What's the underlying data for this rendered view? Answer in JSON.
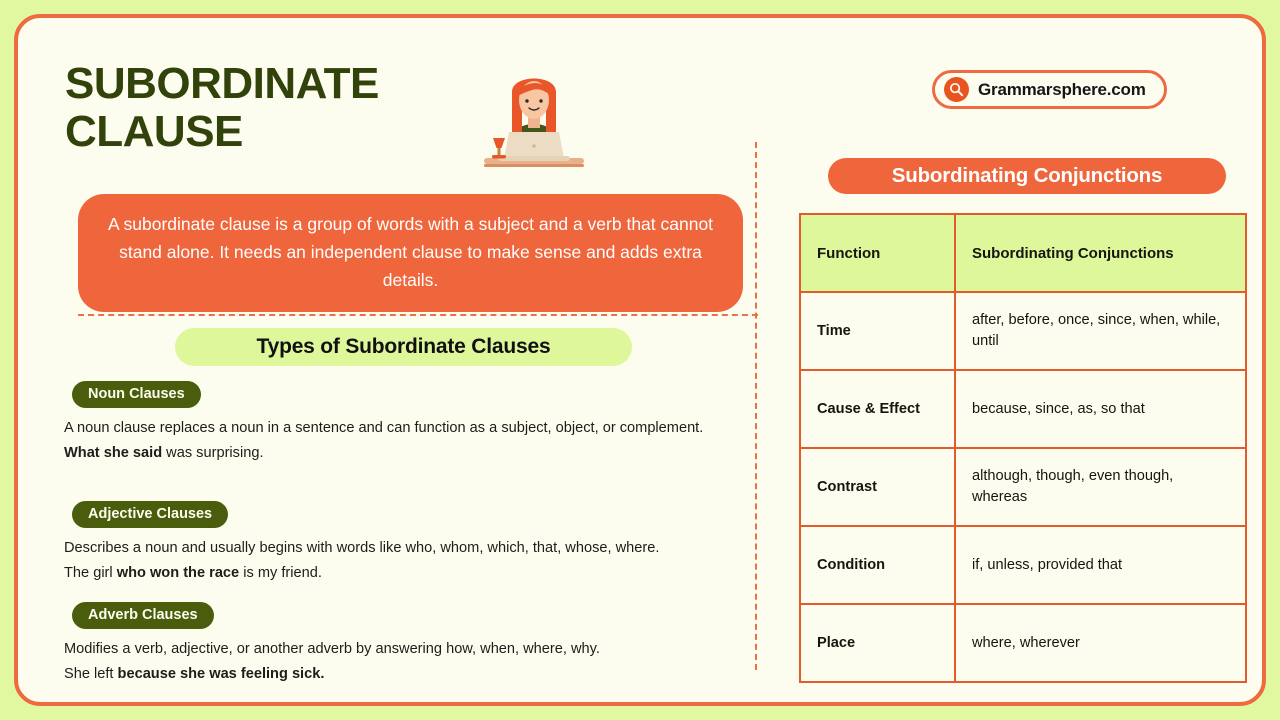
{
  "brand": {
    "name": "Grammarsphere.com",
    "icon": "search-icon",
    "accent": "#ee6b42"
  },
  "header": {
    "title": "SUBORDINATE CLAUSE",
    "illustration": "woman-at-laptop-illustration"
  },
  "definition": {
    "text": "A subordinate clause is a group of words with a subject and a verb that cannot stand alone. It needs an independent clause to make sense and adds extra details.",
    "background": "#f0663c",
    "text_color": "#ffffff"
  },
  "types_section": {
    "heading": "Types of Subordinate Clauses",
    "heading_background": "#ddf79a",
    "pill_background": "#4a5d0d",
    "items": [
      {
        "label": "Noun Clauses",
        "description": "A noun clause replaces a noun in a sentence and can function as a subject, object, or complement.",
        "example_bold": "What she said",
        "example_rest": " was surprising.",
        "example_prefix": ""
      },
      {
        "label": "Adjective Clauses",
        "description": "Describes a noun and usually begins with words like who, whom, which, that, whose, where.",
        "example_prefix": "The girl ",
        "example_bold": "who won the race",
        "example_rest": " is my friend."
      },
      {
        "label": "Adverb Clauses",
        "description": "Modifies a verb, adjective, or another adverb by answering how, when, where, why.",
        "example_prefix": "She left ",
        "example_bold": "because she was feeling sick.",
        "example_rest": ""
      }
    ]
  },
  "conjunctions": {
    "heading": "Subordinating Conjunctions",
    "heading_background": "#f0663c",
    "table": {
      "header_background": "#ddf79a",
      "border_color": "#e35b2c",
      "columns": [
        "Function",
        "Subordinating Conjunctions"
      ],
      "rows": [
        {
          "function": "Time",
          "conjunctions": "after, before, once, since, when, while, until"
        },
        {
          "function": "Cause & Effect",
          "conjunctions": "because, since, as, so that"
        },
        {
          "function": "Contrast",
          "conjunctions": "although, though, even though, whereas"
        },
        {
          "function": "Condition",
          "conjunctions": "if, unless, provided that"
        },
        {
          "function": "Place",
          "conjunctions": "where, wherever"
        }
      ]
    }
  },
  "theme": {
    "page_background": "#e2f8a0",
    "card_background": "#fdfdef",
    "card_border": "#ee6b42",
    "title_color": "#32420b",
    "divider_color": "#e8714a"
  }
}
